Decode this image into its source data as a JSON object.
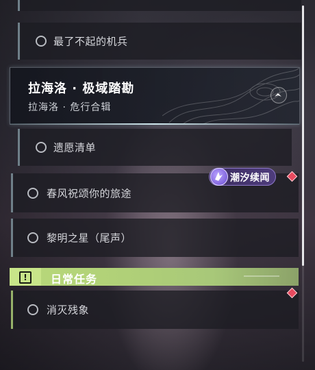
{
  "quests": {
    "top_partial": {},
    "item1": {
      "label": "最了不起的机兵"
    },
    "chapter": {
      "title": "拉海洛 · 极域踏勘",
      "subtitle": "拉海洛 · 危行合辑"
    },
    "item2": {
      "label": "遗愿清单"
    },
    "item3": {
      "label": "春风祝颂你的旅途"
    },
    "item4": {
      "label": "黎明之星（尾声）"
    }
  },
  "event_badge": {
    "label": "潮汐续闻"
  },
  "daily": {
    "section_title": "日常任务",
    "icon_symbol": "!",
    "item1": {
      "label": "消灭残象"
    }
  },
  "colors": {
    "accent_green": "#b9d97a",
    "badge_purple": "#4e3c7c",
    "alert_red": "#e84a5f"
  }
}
